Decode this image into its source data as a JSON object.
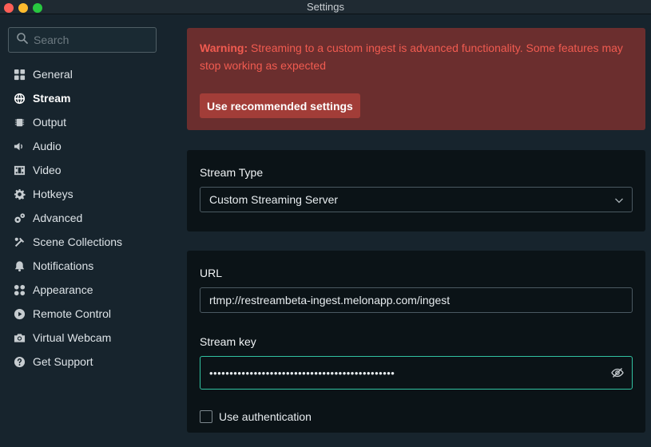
{
  "window": {
    "title": "Settings"
  },
  "search": {
    "placeholder": "Search"
  },
  "sidebar": {
    "items": [
      {
        "label": "General",
        "icon": "grid-icon"
      },
      {
        "label": "Stream",
        "icon": "globe-icon",
        "active": true
      },
      {
        "label": "Output",
        "icon": "chip-icon"
      },
      {
        "label": "Audio",
        "icon": "speaker-icon"
      },
      {
        "label": "Video",
        "icon": "film-icon"
      },
      {
        "label": "Hotkeys",
        "icon": "gear-icon"
      },
      {
        "label": "Advanced",
        "icon": "gears-icon"
      },
      {
        "label": "Scene Collections",
        "icon": "tools-icon"
      },
      {
        "label": "Notifications",
        "icon": "bell-icon"
      },
      {
        "label": "Appearance",
        "icon": "palette-icon"
      },
      {
        "label": "Remote Control",
        "icon": "play-circle-icon"
      },
      {
        "label": "Virtual Webcam",
        "icon": "camera-icon"
      },
      {
        "label": "Get Support",
        "icon": "help-icon"
      }
    ]
  },
  "warning": {
    "prefix": "Warning:",
    "message": " Streaming to a custom ingest is advanced functionality. Some features may stop working as expected",
    "button_label": "Use recommended settings"
  },
  "stream_type": {
    "label": "Stream Type",
    "value": "Custom Streaming Server"
  },
  "url": {
    "label": "URL",
    "value": "rtmp://restreambeta-ingest.melonapp.com/ingest"
  },
  "stream_key": {
    "label": "Stream key",
    "masked_value": "••••••••••••••••••••••••••••••••••••••••••••••"
  },
  "auth": {
    "label": "Use authentication",
    "checked": false
  },
  "colors": {
    "accent": "#31c3a2",
    "warning_bg": "#6b2e2e",
    "warning_text": "#f15b50",
    "warning_button": "#a23d38"
  }
}
